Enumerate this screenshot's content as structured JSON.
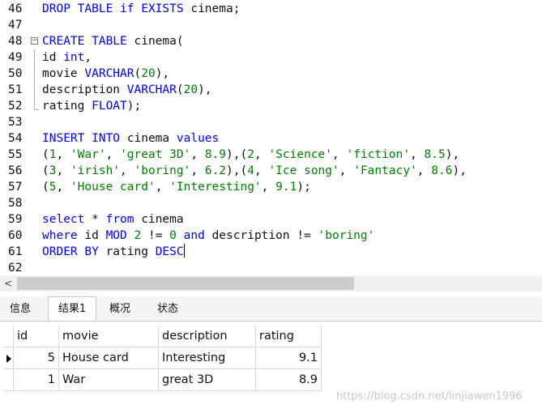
{
  "editor": {
    "lines": [
      {
        "n": "46",
        "t": [
          [
            "kw",
            "DROP TABLE if EXISTS"
          ],
          [
            "pl",
            " cinema;"
          ]
        ]
      },
      {
        "n": "47",
        "t": []
      },
      {
        "n": "48",
        "fold": true,
        "t": [
          [
            "kw",
            "CREATE TABLE"
          ],
          [
            "pl",
            " cinema("
          ]
        ]
      },
      {
        "n": "49",
        "t": [
          [
            "pl",
            "id "
          ],
          [
            "kw",
            "int"
          ],
          [
            "pl",
            ","
          ]
        ]
      },
      {
        "n": "50",
        "t": [
          [
            "pl",
            "movie "
          ],
          [
            "kw",
            "VARCHAR"
          ],
          [
            "pl",
            "("
          ],
          [
            "num",
            "20"
          ],
          [
            "pl",
            "),"
          ]
        ]
      },
      {
        "n": "51",
        "t": [
          [
            "pl",
            "description "
          ],
          [
            "kw",
            "VARCHAR"
          ],
          [
            "pl",
            "("
          ],
          [
            "num",
            "20"
          ],
          [
            "pl",
            "),"
          ]
        ]
      },
      {
        "n": "52",
        "t": [
          [
            "pl",
            "rating "
          ],
          [
            "kw",
            "FLOAT"
          ],
          [
            "pl",
            ");"
          ]
        ]
      },
      {
        "n": "53",
        "t": []
      },
      {
        "n": "54",
        "t": [
          [
            "kw",
            "INSERT INTO"
          ],
          [
            "pl",
            " cinema "
          ],
          [
            "kw",
            "values"
          ]
        ]
      },
      {
        "n": "55",
        "t": [
          [
            "pl",
            "("
          ],
          [
            "num",
            "1"
          ],
          [
            "pl",
            ", "
          ],
          [
            "str",
            "'War'"
          ],
          [
            "pl",
            ", "
          ],
          [
            "str",
            "'great 3D'"
          ],
          [
            "pl",
            ", "
          ],
          [
            "num",
            "8.9"
          ],
          [
            "pl",
            "),("
          ],
          [
            "num",
            "2"
          ],
          [
            "pl",
            ", "
          ],
          [
            "str",
            "'Science'"
          ],
          [
            "pl",
            ", "
          ],
          [
            "str",
            "'fiction'"
          ],
          [
            "pl",
            ", "
          ],
          [
            "num",
            "8.5"
          ],
          [
            "pl",
            "),"
          ]
        ]
      },
      {
        "n": "56",
        "t": [
          [
            "pl",
            "("
          ],
          [
            "num",
            "3"
          ],
          [
            "pl",
            ", "
          ],
          [
            "str",
            "'irish'"
          ],
          [
            "pl",
            ", "
          ],
          [
            "str",
            "'boring'"
          ],
          [
            "pl",
            ", "
          ],
          [
            "num",
            "6.2"
          ],
          [
            "pl",
            "),("
          ],
          [
            "num",
            "4"
          ],
          [
            "pl",
            ", "
          ],
          [
            "str",
            "'Ice song'"
          ],
          [
            "pl",
            ", "
          ],
          [
            "str",
            "'Fantacy'"
          ],
          [
            "pl",
            ", "
          ],
          [
            "num",
            "8.6"
          ],
          [
            "pl",
            "),"
          ]
        ]
      },
      {
        "n": "57",
        "t": [
          [
            "pl",
            "("
          ],
          [
            "num",
            "5"
          ],
          [
            "pl",
            ", "
          ],
          [
            "str",
            "'House card'"
          ],
          [
            "pl",
            ", "
          ],
          [
            "str",
            "'Interesting'"
          ],
          [
            "pl",
            ", "
          ],
          [
            "num",
            "9.1"
          ],
          [
            "pl",
            ");"
          ]
        ]
      },
      {
        "n": "58",
        "t": []
      },
      {
        "n": "59",
        "t": [
          [
            "kw",
            "select"
          ],
          [
            "pl",
            " * "
          ],
          [
            "kw",
            "from"
          ],
          [
            "pl",
            " cinema"
          ]
        ]
      },
      {
        "n": "60",
        "t": [
          [
            "kw",
            "where"
          ],
          [
            "pl",
            " id "
          ],
          [
            "kw",
            "MOD"
          ],
          [
            "pl",
            " "
          ],
          [
            "num",
            "2"
          ],
          [
            "pl",
            " != "
          ],
          [
            "num",
            "0"
          ],
          [
            "pl",
            " "
          ],
          [
            "kw",
            "and"
          ],
          [
            "pl",
            " description != "
          ],
          [
            "str",
            "'boring'"
          ]
        ]
      },
      {
        "n": "61",
        "caret": true,
        "t": [
          [
            "kw",
            "ORDER BY"
          ],
          [
            "pl",
            " rating "
          ],
          [
            "kw",
            "DESC"
          ]
        ]
      },
      {
        "n": "62",
        "t": []
      }
    ]
  },
  "scrollbar": {
    "left_arrow": "<"
  },
  "tabs": [
    "信息",
    "结果1",
    "概况",
    "状态"
  ],
  "active_tab": 1,
  "result": {
    "columns": [
      "id",
      "movie",
      "description",
      "rating"
    ],
    "rows": [
      [
        "5",
        "House card",
        "Interesting",
        "9.1"
      ],
      [
        "1",
        "War",
        "great 3D",
        "8.9"
      ]
    ]
  },
  "watermark": "https://blog.csdn.net/linjiawen1996",
  "colors": {
    "keyword": "#0000ff",
    "string": "#008000",
    "number": "#008000"
  }
}
